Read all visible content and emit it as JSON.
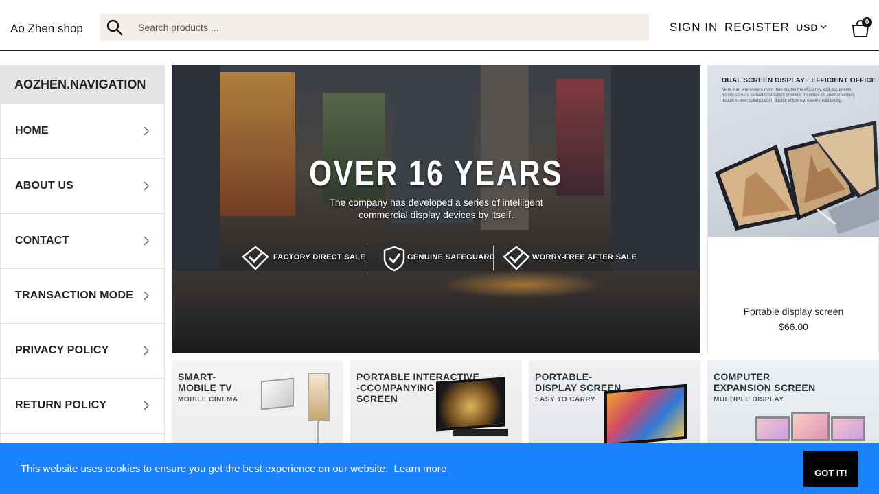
{
  "header": {
    "logo": "Ao Zhen shop",
    "search_placeholder": "Search products ...",
    "sign_in": "SIGN IN",
    "register": "REGISTER",
    "currency": "USD",
    "cart_count": "0",
    "icons": {
      "search": "search-icon",
      "currency_dropdown": "chevron-down-icon",
      "cart": "shopping-bag-icon"
    }
  },
  "sidebar": {
    "title": "AOZHEN.NAVIGATION",
    "items": [
      {
        "label": "HOME"
      },
      {
        "label": "ABOUT US"
      },
      {
        "label": "CONTACT"
      },
      {
        "label": "TRANSACTION MODE"
      },
      {
        "label": "PRIVACY POLICY"
      },
      {
        "label": "RETURN POLICY"
      }
    ]
  },
  "banner": {
    "title": "OVER  16  YEARS",
    "subtitle_line1": "The company has developed a series of intelligent",
    "subtitle_line2": "commercial display devices by itself.",
    "badges": [
      {
        "label": "FACTORY DIRECT SALE",
        "icon": "diamond-check-icon"
      },
      {
        "label": "GENUINE SAFEGUARD",
        "icon": "shield-check-icon"
      },
      {
        "label": "WORRY-FREE AFTER SALE",
        "icon": "diamond-check-icon"
      }
    ]
  },
  "featured_product": {
    "image_title": "DUAL SCREEN DISPLAY · EFFICIENT OFFICE",
    "image_desc": "More than one screen, more than double the efficiency, edit documents on one screen, consult information or online meetings on another screen, double screen collaboration, double efficiency, easier multitasking.",
    "name": "Portable display screen",
    "price": "$66.00"
  },
  "categories": [
    {
      "title": "SMART-\nMOBILE TV",
      "subtitle": "MOBILE CINEMA"
    },
    {
      "title": "PORTABLE INTERACTIVE\n-CCOMPANYING\nSCREEN",
      "subtitle": ""
    },
    {
      "title": "PORTABLE-\nDISPLAY SCREEN",
      "subtitle": "EASY TO CARRY"
    },
    {
      "title": "COMPUTER\nEXPANSION SCREEN",
      "subtitle": "MULTIPLE DISPLAY"
    }
  ],
  "cookie": {
    "message": "This website uses cookies to ensure you get the best experience on our website.",
    "learn_more": "Learn more",
    "button": "GOT IT!"
  },
  "colors": {
    "cookie_bar": "#1a82ff",
    "button_dark": "#000000",
    "sidebar_title_bg": "#e5e5e5",
    "search_bg": "#f2efeb"
  }
}
